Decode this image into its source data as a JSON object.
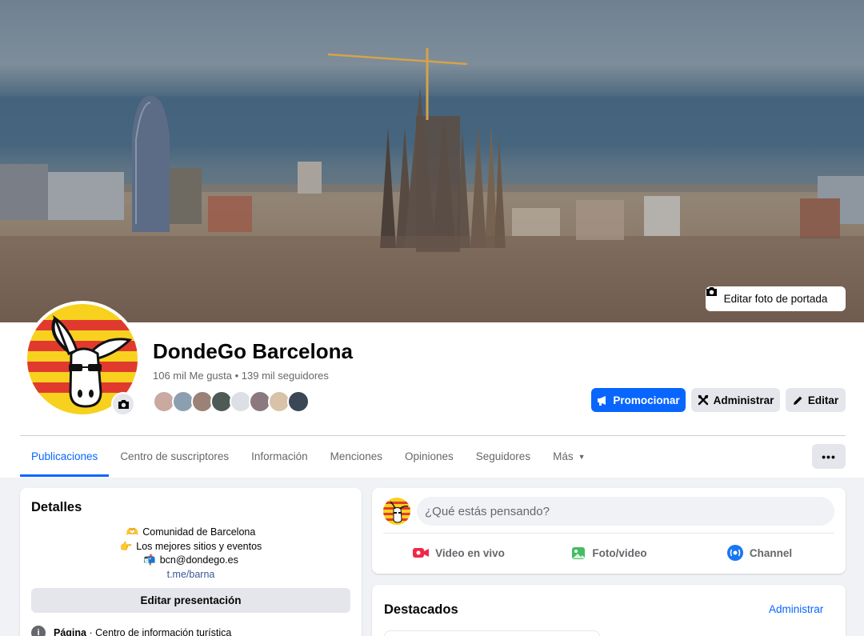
{
  "cover": {
    "edit_label": "Editar foto de portada",
    "icon": "camera-icon"
  },
  "page": {
    "name": "DondeGo Barcelona",
    "stats": "106 mil Me gusta • 139 mil seguidores"
  },
  "friend_colors": [
    "#c9a9a0",
    "#8c9fb0",
    "#9a8276",
    "#4d5a55",
    "#dcdfe3",
    "#8a7a80",
    "#d8c3a8",
    "#3b4754"
  ],
  "actions": {
    "promote_label": "Promocionar",
    "admin_label": "Administrar",
    "edit_label": "Editar"
  },
  "tabs": [
    {
      "label": "Publicaciones",
      "active": true
    },
    {
      "label": "Centro de suscriptores"
    },
    {
      "label": "Información"
    },
    {
      "label": "Menciones"
    },
    {
      "label": "Opiniones"
    },
    {
      "label": "Seguidores"
    },
    {
      "label": "Más"
    }
  ],
  "more_button": "•••",
  "details": {
    "title": "Detalles",
    "bio": {
      "line1_icon": "🫶",
      "line1": "Comunidad de Barcelona",
      "line2_icon": "👉",
      "line2": "Los mejores sitios y eventos",
      "line3_icon": "📬",
      "line3": "bcn@dondego.es",
      "link": "t.me/barna"
    },
    "edit_intro": "Editar presentación",
    "category_label": "Página",
    "category": " · Centro de información turística"
  },
  "composer": {
    "placeholder": "¿Qué estás pensando?",
    "live": "Video en vivo",
    "photo": "Foto/video",
    "channel": "Channel"
  },
  "featured": {
    "title": "Destacados",
    "admin": "Administrar"
  },
  "colors": {
    "accent": "#0866ff",
    "live_red": "#f02849",
    "photo_green": "#45bd62",
    "channel_blue": "#1877f2",
    "flag_yellow": "#f7d11e",
    "flag_red": "#e03a2f"
  }
}
